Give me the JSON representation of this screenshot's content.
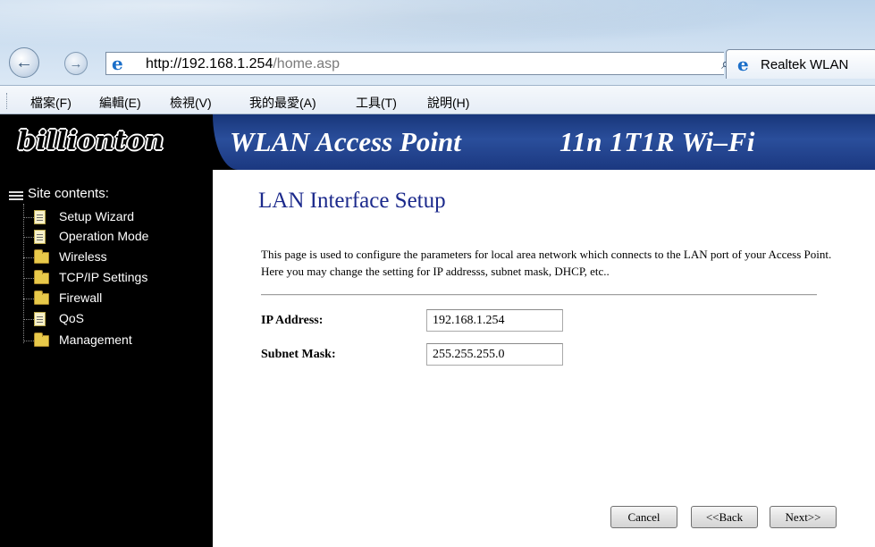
{
  "browser": {
    "url_host": "http://192.168.1.254",
    "url_path": "/home.asp",
    "address_tools": [
      "⌕",
      "▾",
      "↻",
      "✕"
    ],
    "tab_title": "Realtek WLAN",
    "menu": [
      "檔案(F)",
      "編輯(E)",
      "檢視(V)",
      "我的最愛(A)",
      "工具(T)",
      "說明(H)"
    ]
  },
  "header": {
    "logo": "billionton",
    "title_left": "WLAN Access Point",
    "title_right": "11n  1T1R Wi–Fi",
    "accent_color": "#1c3a86"
  },
  "sidebar": {
    "heading": "Site contents:",
    "items": [
      {
        "label": "Setup Wizard",
        "icon": "document-icon"
      },
      {
        "label": "Operation Mode",
        "icon": "document-icon"
      },
      {
        "label": "Wireless",
        "icon": "folder-icon"
      },
      {
        "label": "TCP/IP Settings",
        "icon": "folder-icon"
      },
      {
        "label": "Firewall",
        "icon": "folder-icon"
      },
      {
        "label": "QoS",
        "icon": "document-icon"
      },
      {
        "label": "Management",
        "icon": "folder-icon"
      }
    ]
  },
  "main": {
    "title": "LAN Interface Setup",
    "description": "This page is used to configure the parameters for local area network which connects to the LAN port of your Access Point. Here you may change the setting for IP addresss, subnet mask, DHCP, etc..",
    "fields": [
      {
        "label": "IP Address:",
        "value": "192.168.1.254"
      },
      {
        "label": "Subnet Mask:",
        "value": "255.255.255.0"
      }
    ],
    "buttons": {
      "cancel": "Cancel",
      "back": "<<Back",
      "next": "Next>>"
    }
  }
}
